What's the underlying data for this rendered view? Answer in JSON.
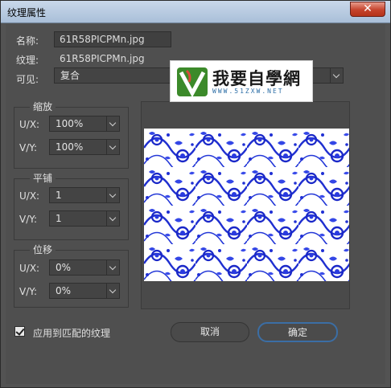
{
  "window": {
    "title": "纹理属性",
    "close_glyph": "✕"
  },
  "fields": {
    "name_label": "名称:",
    "name_value": "61R58PICPMn.jpg",
    "texture_label": "纹理:",
    "texture_value": "61R58PICPMn.jpg",
    "visible_label": "可见:",
    "visible_value": "复合"
  },
  "scale": {
    "title": "缩放",
    "ux_label": "U/X:",
    "ux_value": "100%",
    "vy_label": "V/Y:",
    "vy_value": "100%"
  },
  "tile": {
    "title": "平铺",
    "ux_label": "U/X:",
    "ux_value": "1",
    "vy_label": "V/Y:",
    "vy_value": "1"
  },
  "offset": {
    "title": "位移",
    "ux_label": "U/X:",
    "ux_value": "0%",
    "vy_label": "V/Y:",
    "vy_value": "0%"
  },
  "apply_matching": {
    "label": "应用到匹配的纹理",
    "checked": true
  },
  "buttons": {
    "cancel": "取消",
    "ok": "确定"
  },
  "watermark": {
    "text": "我要自學網",
    "url": "WWW.51ZXW.NET"
  },
  "colors": {
    "accent": "#3b6ea5",
    "pattern_blue": "#1f2fd0"
  }
}
